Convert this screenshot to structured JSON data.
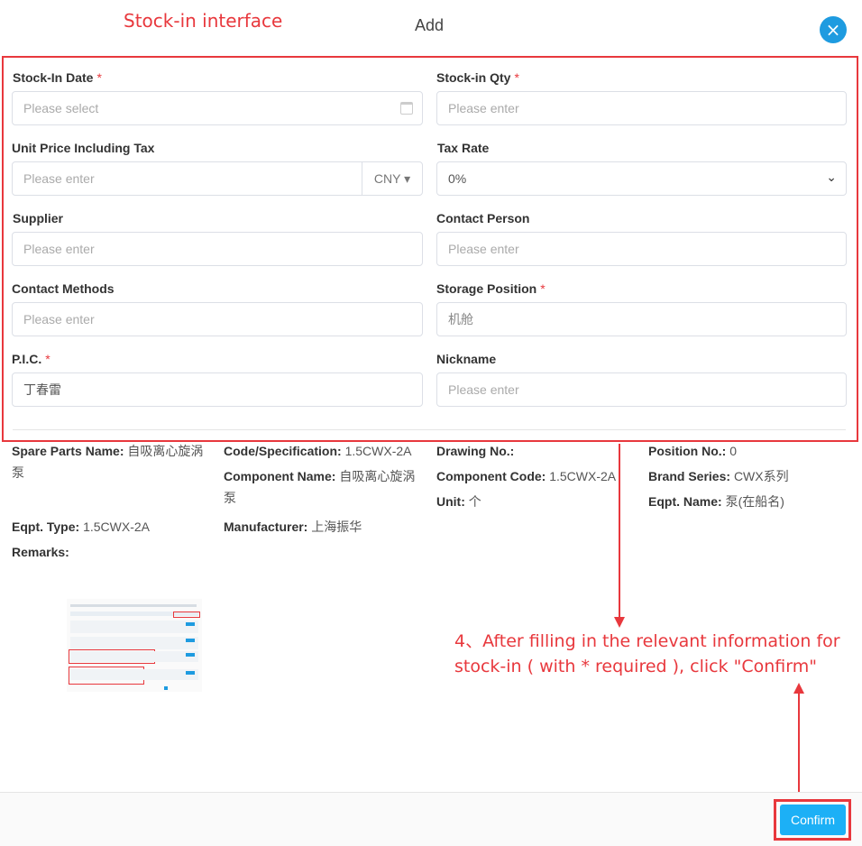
{
  "annotation": {
    "title": "Stock-in interface",
    "step_line1": "4、After filling in the relevant information for",
    "step_line2": "stock-in ( with * required ), click \"Confirm\""
  },
  "modal": {
    "title": "Add",
    "close_icon": "×"
  },
  "form": {
    "required_mark": "*",
    "stock_in_date": {
      "label": "Stock-In Date",
      "placeholder": "Please select"
    },
    "stock_in_qty": {
      "label": "Stock-in Qty",
      "placeholder": "Please enter"
    },
    "unit_price": {
      "label": "Unit Price Including Tax",
      "placeholder": "Please enter",
      "currency": "CNY ▾"
    },
    "tax_rate": {
      "label": "Tax Rate",
      "value": "0%"
    },
    "supplier": {
      "label": "Supplier",
      "placeholder": "Please enter"
    },
    "contact_person": {
      "label": "Contact Person",
      "placeholder": "Please enter"
    },
    "contact_methods": {
      "label": "Contact Methods",
      "placeholder": "Please enter"
    },
    "storage_position": {
      "label": "Storage Position",
      "value": "机舱"
    },
    "pic": {
      "label": "P.I.C.",
      "value": "丁春雷"
    },
    "nickname": {
      "label": "Nickname",
      "placeholder": "Please enter"
    }
  },
  "details": {
    "spare_parts_name": {
      "label": "Spare Parts Name:",
      "value": "自吸离心旋涡",
      "value2": "泵"
    },
    "code_spec": {
      "label": "Code/Specification:",
      "value": "1.5CWX-2A"
    },
    "drawing_no": {
      "label": "Drawing No.:",
      "value": ""
    },
    "position_no": {
      "label": "Position No.:",
      "value": "0"
    },
    "component_name": {
      "label": "Component Name:",
      "value": "自吸离心旋涡",
      "value2": "泵"
    },
    "component_code": {
      "label": "Component Code:",
      "value": "1.5CWX-2A"
    },
    "brand_series": {
      "label": "Brand Series:",
      "value": "CWX系列"
    },
    "unit": {
      "label": "Unit:",
      "value": "个"
    },
    "eqpt_name": {
      "label": "Eqpt. Name:",
      "value": "泵(在船名)"
    },
    "eqpt_type": {
      "label": "Eqpt. Type:",
      "value": "1.5CWX-2A"
    },
    "manufacturer": {
      "label": "Manufacturer:",
      "value": "上海振华"
    },
    "remarks": {
      "label": "Remarks:",
      "value": ""
    }
  },
  "footer": {
    "confirm_label": "Confirm"
  },
  "colors": {
    "accent": "#1cb0f6",
    "annotation_red": "#e8383d"
  }
}
